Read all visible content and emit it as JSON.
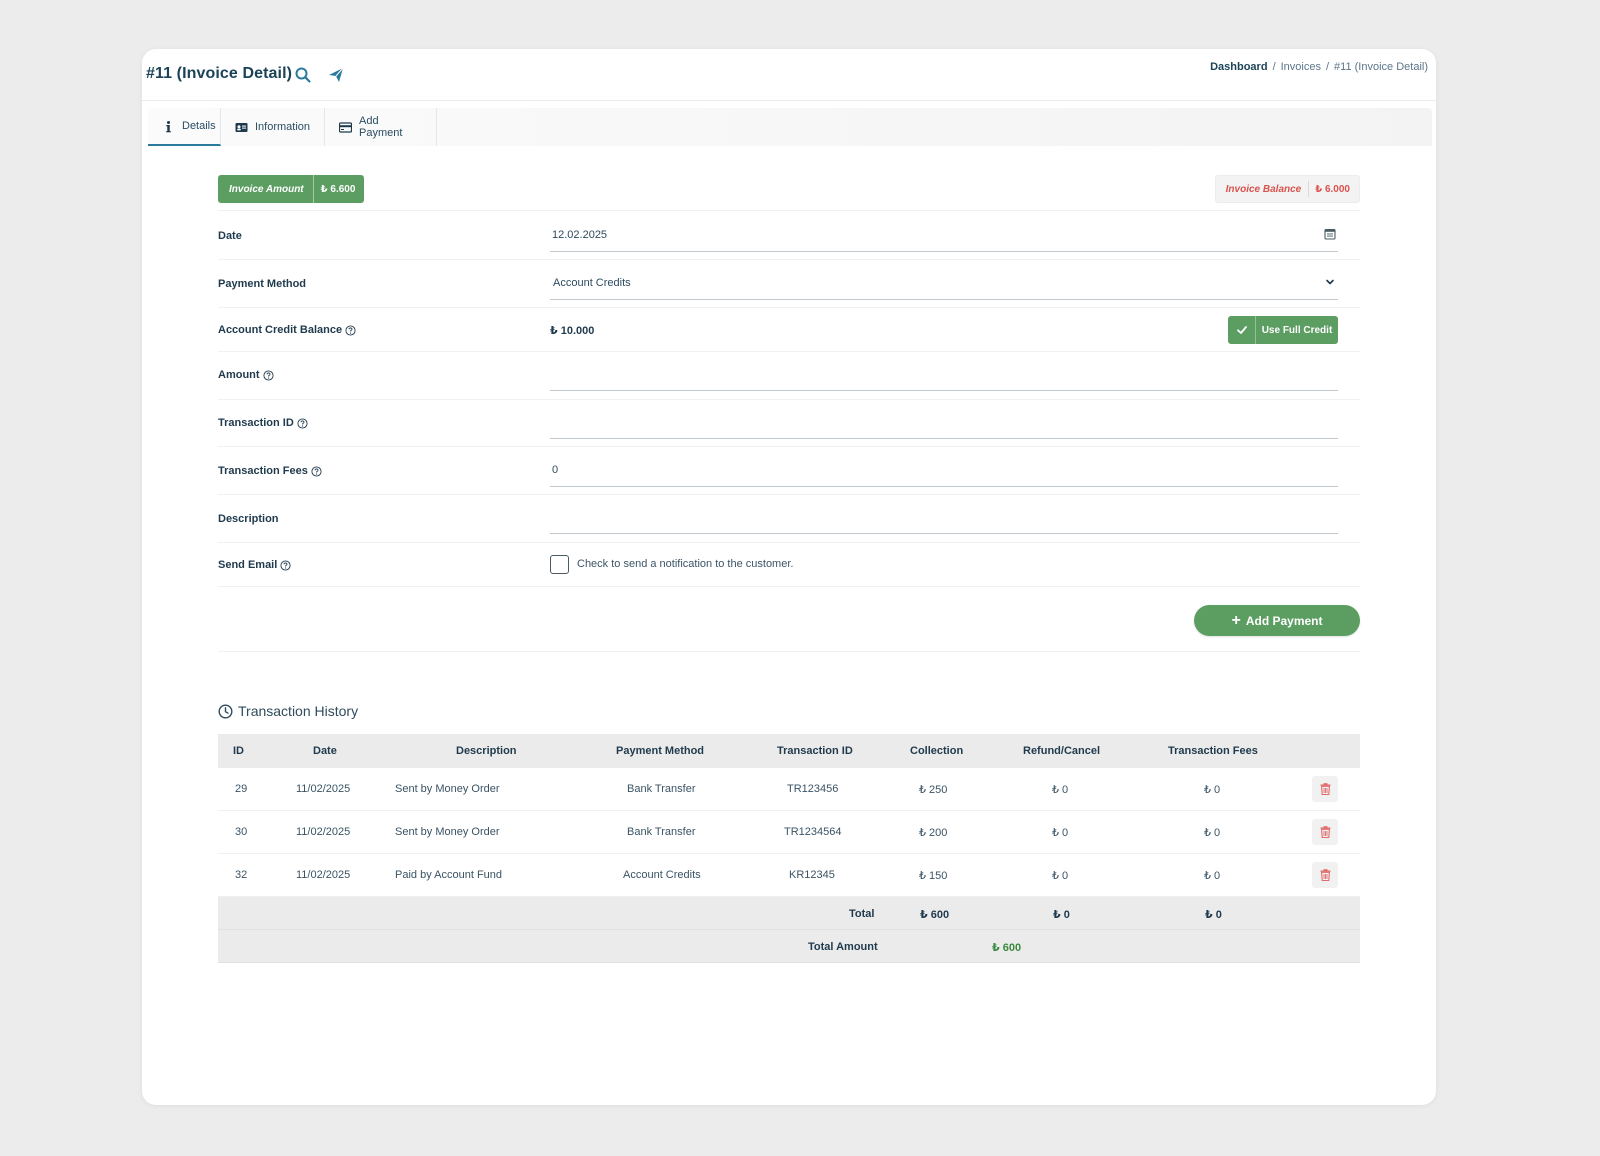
{
  "header": {
    "title": "#11 (Invoice Detail)",
    "breadcrumb": [
      "Dashboard",
      "Invoices",
      "#11 (Invoice Detail)"
    ],
    "breadcrumb_sep": "/"
  },
  "tabs": [
    {
      "label": "Details",
      "icon": "info-icon",
      "active": true
    },
    {
      "label": "Information",
      "icon": "id-card-icon",
      "active": false
    },
    {
      "label": "Add Payment",
      "icon": "credit-card-icon",
      "active": false
    }
  ],
  "summary": {
    "invoice_amount_label": "Invoice Amount",
    "invoice_amount_value": "₺ 6.600",
    "invoice_balance_label": "Invoice Balance",
    "invoice_balance_value": "₺ 6.000"
  },
  "form": {
    "date_label": "Date",
    "date_value": "12.02.2025",
    "payment_method_label": "Payment Method",
    "payment_method_value": "Account Credits",
    "credit_balance_label": "Account Credit Balance",
    "credit_balance_value": "₺ 10.000",
    "use_full_credit_label": "Use Full Credit",
    "amount_label": "Amount",
    "amount_value": "",
    "transaction_id_label": "Transaction ID",
    "transaction_id_value": "",
    "transaction_fees_label": "Transaction Fees",
    "transaction_fees_value": "0",
    "description_label": "Description",
    "description_value": "",
    "send_email_label": "Send Email",
    "send_email_text": "Check to send a notification to the customer.",
    "send_email_checked": false,
    "add_payment_label": "Add Payment",
    "add_payment_plus": "+"
  },
  "history": {
    "title": "Transaction History",
    "columns": [
      "ID",
      "Date",
      "Description",
      "Payment Method",
      "Transaction ID",
      "Collection",
      "Refund/Cancel",
      "Transaction Fees"
    ],
    "rows": [
      {
        "id": "29",
        "date": "11/02/2025",
        "description": "Sent by Money Order",
        "method": "Bank Transfer",
        "txid": "TR123456",
        "collection": "₺ 250",
        "refund": "₺ 0",
        "fees": "₺ 0"
      },
      {
        "id": "30",
        "date": "11/02/2025",
        "description": "Sent by Money Order",
        "method": "Bank Transfer",
        "txid": "TR1234564",
        "collection": "₺ 200",
        "refund": "₺ 0",
        "fees": "₺ 0"
      },
      {
        "id": "32",
        "date": "11/02/2025",
        "description": "Paid by Account Fund",
        "method": "Account Credits",
        "txid": "KR12345",
        "collection": "₺ 150",
        "refund": "₺ 0",
        "fees": "₺ 0"
      }
    ],
    "total_label": "Total",
    "total_collection": "₺ 600",
    "total_refund": "₺ 0",
    "total_fees": "₺ 0",
    "total_amount_label": "Total Amount",
    "total_amount_value": "₺ 600"
  },
  "colors": {
    "accent_green": "#5c9e62",
    "danger_red": "#d9534f",
    "title_navy": "#1b4357"
  }
}
